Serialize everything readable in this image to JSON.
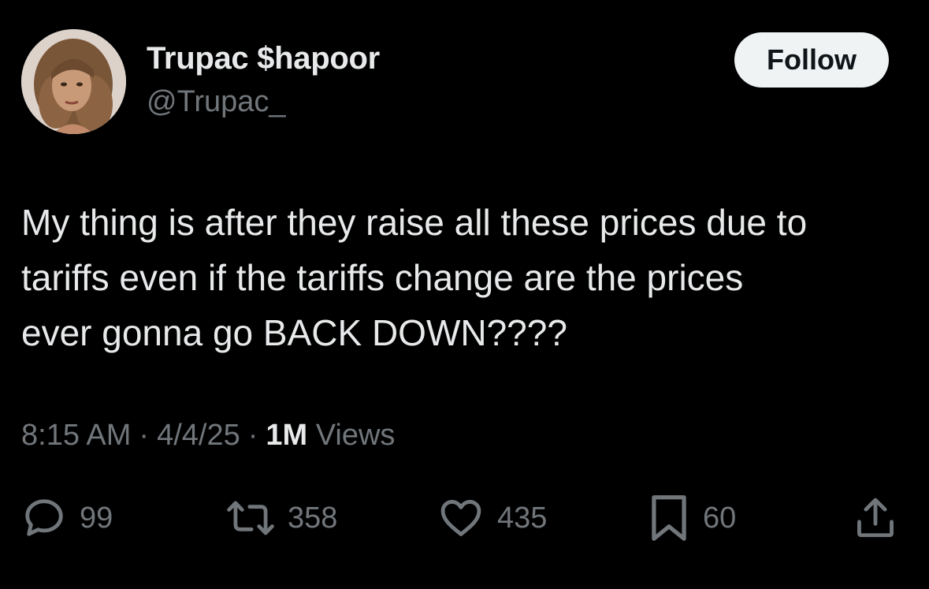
{
  "user": {
    "display_name": "Trupac $hapoor",
    "handle": "@Trupac_"
  },
  "follow_button": {
    "label": "Follow"
  },
  "tweet": {
    "lines": [
      "My thing is after they raise all these prices due to",
      "tariffs even if the tariffs change are the prices",
      "ever gonna go BACK DOWN????"
    ]
  },
  "meta": {
    "time": "8:15 AM",
    "separator": "·",
    "date": "4/4/25",
    "views_count": "1M",
    "views_label": "Views"
  },
  "actions": {
    "replies": {
      "icon": "reply-icon",
      "count": "99"
    },
    "retweets": {
      "icon": "retweet-icon",
      "count": "358"
    },
    "likes": {
      "icon": "heart-icon",
      "count": "435"
    },
    "bookmarks": {
      "icon": "bookmark-icon",
      "count": "60"
    },
    "share": {
      "icon": "share-icon"
    }
  },
  "colors": {
    "background": "#000000",
    "primary_text": "#e7e9ea",
    "secondary_text": "#71767b",
    "follow_button_bg": "#eff3f4",
    "follow_button_text": "#0f1419"
  }
}
